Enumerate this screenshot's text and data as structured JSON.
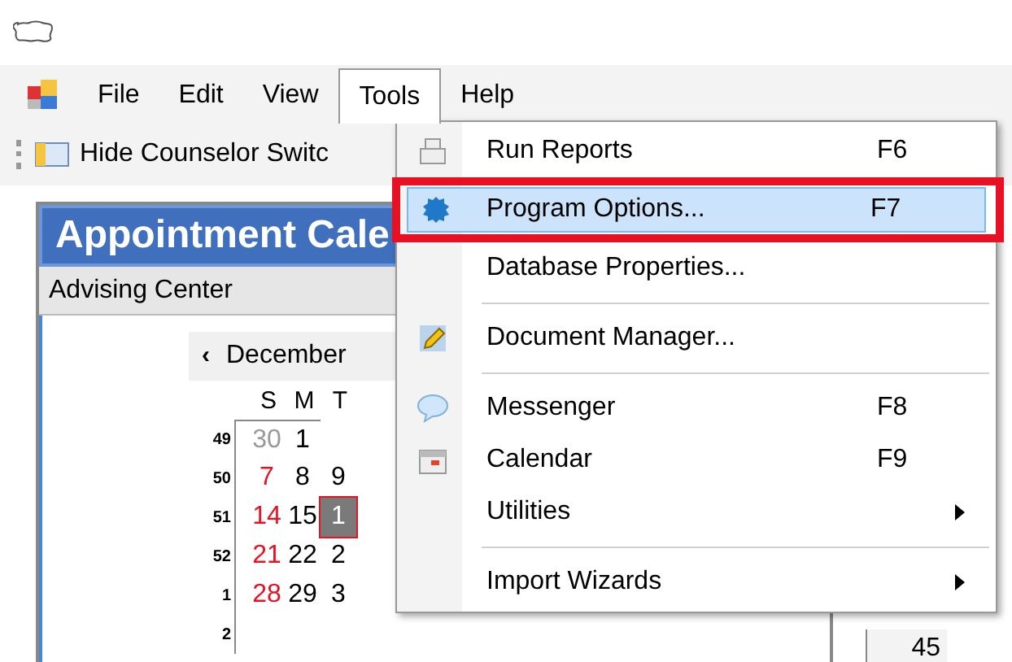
{
  "menu_bar": [
    {
      "label": "File",
      "selected": false
    },
    {
      "label": "Edit",
      "selected": false
    },
    {
      "label": "View",
      "selected": false
    },
    {
      "label": "Tools",
      "selected": true
    },
    {
      "label": "Help",
      "selected": false
    }
  ],
  "toolbar": {
    "button": "Hide Counselor Switc"
  },
  "panel": {
    "title": "Appointment Cale",
    "subtitle": "Advising Center"
  },
  "calendar": {
    "prev": "‹",
    "month": "December",
    "weekdays": [
      "S",
      "M",
      "T"
    ],
    "weeks": [
      {
        "number": "49",
        "days": [
          {
            "text": "30",
            "kind": "other"
          },
          {
            "text": "1",
            "kind": "normal"
          }
        ]
      },
      {
        "number": "50",
        "days": [
          {
            "text": "7",
            "kind": "weekend"
          },
          {
            "text": "8",
            "kind": "normal"
          },
          {
            "text": "9",
            "kind": "normal"
          }
        ]
      },
      {
        "number": "51",
        "days": [
          {
            "text": "14",
            "kind": "weekend"
          },
          {
            "text": "15",
            "kind": "normal"
          },
          {
            "text": "1",
            "kind": "today"
          }
        ]
      },
      {
        "number": "52",
        "days": [
          {
            "text": "21",
            "kind": "weekend"
          },
          {
            "text": "22",
            "kind": "normal"
          },
          {
            "text": "2",
            "kind": "normal"
          }
        ]
      },
      {
        "number": "1",
        "days": [
          {
            "text": "28",
            "kind": "weekend"
          },
          {
            "text": "29",
            "kind": "normal"
          },
          {
            "text": "3",
            "kind": "normal"
          }
        ]
      },
      {
        "number": "2"
      }
    ]
  },
  "side_cell": "45",
  "tools_menu": [
    {
      "kind": "item",
      "label": "Run Reports",
      "shortcut": "F6",
      "selected": false
    },
    {
      "kind": "item",
      "label": "Program Options...",
      "shortcut": "F7",
      "selected": true
    },
    {
      "kind": "item",
      "label": "Database Properties...",
      "selected": false
    },
    {
      "kind": "separator"
    },
    {
      "kind": "item",
      "label": "Document Manager...",
      "selected": false
    },
    {
      "kind": "separator"
    },
    {
      "kind": "item",
      "label": "Messenger",
      "shortcut": "F8",
      "selected": false
    },
    {
      "kind": "item",
      "label": "Calendar",
      "shortcut": "F9",
      "selected": false
    },
    {
      "kind": "submenu",
      "label": "Utilities",
      "selected": false
    },
    {
      "kind": "separator"
    },
    {
      "kind": "submenu",
      "label": "Import Wizards",
      "selected": false
    }
  ]
}
